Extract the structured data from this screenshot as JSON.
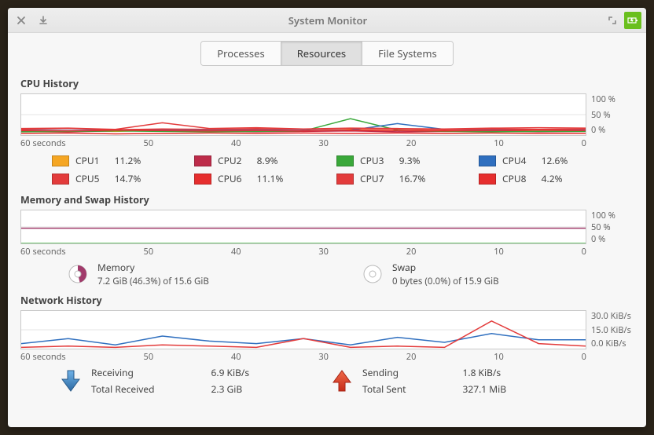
{
  "window_title": "System Monitor",
  "tabs": {
    "processes": "Processes",
    "resources": "Resources",
    "filesystems": "File Systems"
  },
  "sections": {
    "cpu_title": "CPU History",
    "mem_title": "Memory and Swap History",
    "net_title": "Network History"
  },
  "time_axis_label_suffix": " seconds",
  "time_ticks": [
    "60",
    "50",
    "40",
    "30",
    "20",
    "10",
    "0"
  ],
  "cpu": {
    "y_ticks": [
      "100 %",
      "50 %",
      "0 %"
    ],
    "cores": [
      {
        "name": "CPU1",
        "value": "11.2%",
        "color": "#f5a623"
      },
      {
        "name": "CPU2",
        "value": "8.9%",
        "color": "#bd2c4a"
      },
      {
        "name": "CPU3",
        "value": "9.3%",
        "color": "#3aa83a"
      },
      {
        "name": "CPU4",
        "value": "12.6%",
        "color": "#2f6fbf"
      },
      {
        "name": "CPU5",
        "value": "14.7%",
        "color": "#e33b3b"
      },
      {
        "name": "CPU6",
        "value": "11.1%",
        "color": "#e62e2e"
      },
      {
        "name": "CPU7",
        "value": "16.7%",
        "color": "#e33b3b"
      },
      {
        "name": "CPU8",
        "value": "4.2%",
        "color": "#e62e2e"
      }
    ]
  },
  "memory": {
    "y_ticks": [
      "100 %",
      "50 %",
      "0 %"
    ],
    "mem_label": "Memory",
    "mem_value": "7.2 GiB (46.3%) of 15.6 GiB",
    "mem_fraction": 0.463,
    "mem_color": "#a13b6b",
    "swap_label": "Swap",
    "swap_value": "0 bytes (0.0%) of 15.9 GiB",
    "swap_fraction": 0.0,
    "swap_color": "#47b647"
  },
  "network": {
    "y_ticks": [
      "30.0 KiB/s",
      "15.0 KiB/s",
      "0.0 KiB/s"
    ],
    "recv_label": "Receiving",
    "recv_rate": "6.9 KiB/s",
    "recv_total_label": "Total Received",
    "recv_total": "2.3 GiB",
    "recv_color": "#2f6fbf",
    "send_label": "Sending",
    "send_rate": "1.8 KiB/s",
    "send_total_label": "Total Sent",
    "send_total": "327.1 MiB",
    "send_color": "#e33b3b"
  },
  "chart_data": [
    {
      "type": "line",
      "title": "CPU History",
      "xlabel": "seconds",
      "ylabel": "%",
      "ylim": [
        0,
        100
      ],
      "x": [
        60,
        55,
        50,
        45,
        40,
        35,
        30,
        25,
        20,
        15,
        10,
        5,
        0
      ],
      "series": [
        {
          "name": "CPU1",
          "values": [
            10,
            11,
            9,
            12,
            10,
            11,
            10,
            13,
            11,
            10,
            9,
            12,
            11
          ]
        },
        {
          "name": "CPU2",
          "values": [
            9,
            8,
            10,
            11,
            9,
            8,
            9,
            10,
            8,
            9,
            10,
            8,
            9
          ]
        },
        {
          "name": "CPU3",
          "values": [
            8,
            9,
            10,
            9,
            8,
            9,
            10,
            40,
            12,
            9,
            8,
            9,
            9
          ]
        },
        {
          "name": "CPU4",
          "values": [
            12,
            11,
            13,
            14,
            12,
            13,
            11,
            12,
            28,
            14,
            12,
            13,
            13
          ]
        },
        {
          "name": "CPU5",
          "values": [
            14,
            16,
            13,
            15,
            14,
            15,
            14,
            16,
            15,
            13,
            15,
            14,
            15
          ]
        },
        {
          "name": "CPU6",
          "values": [
            11,
            10,
            12,
            11,
            10,
            11,
            10,
            12,
            11,
            10,
            11,
            12,
            11
          ]
        },
        {
          "name": "CPU7",
          "values": [
            16,
            17,
            14,
            30,
            16,
            18,
            15,
            17,
            16,
            15,
            17,
            18,
            17
          ]
        },
        {
          "name": "CPU8",
          "values": [
            4,
            5,
            3,
            4,
            5,
            4,
            5,
            4,
            5,
            4,
            5,
            4,
            4
          ]
        }
      ]
    },
    {
      "type": "line",
      "title": "Memory and Swap History",
      "xlabel": "seconds",
      "ylabel": "%",
      "ylim": [
        0,
        100
      ],
      "x": [
        60,
        55,
        50,
        45,
        40,
        35,
        30,
        25,
        20,
        15,
        10,
        5,
        0
      ],
      "series": [
        {
          "name": "Memory",
          "values": [
            46,
            46,
            46,
            46,
            46,
            46,
            46,
            46,
            46,
            46,
            46,
            46,
            46
          ]
        },
        {
          "name": "Swap",
          "values": [
            0,
            0,
            0,
            0,
            0,
            0,
            0,
            0,
            0,
            0,
            0,
            0,
            0
          ]
        }
      ]
    },
    {
      "type": "line",
      "title": "Network History",
      "xlabel": "seconds",
      "ylabel": "KiB/s",
      "ylim": [
        0,
        30
      ],
      "x": [
        60,
        55,
        50,
        45,
        40,
        35,
        30,
        25,
        20,
        15,
        10,
        5,
        0
      ],
      "series": [
        {
          "name": "Receiving",
          "values": [
            4,
            8,
            3,
            10,
            6,
            4,
            8,
            3,
            9,
            5,
            12,
            7,
            7
          ]
        },
        {
          "name": "Sending",
          "values": [
            1,
            2,
            1,
            3,
            2,
            1,
            8,
            1,
            2,
            1,
            22,
            4,
            2
          ]
        }
      ]
    }
  ]
}
